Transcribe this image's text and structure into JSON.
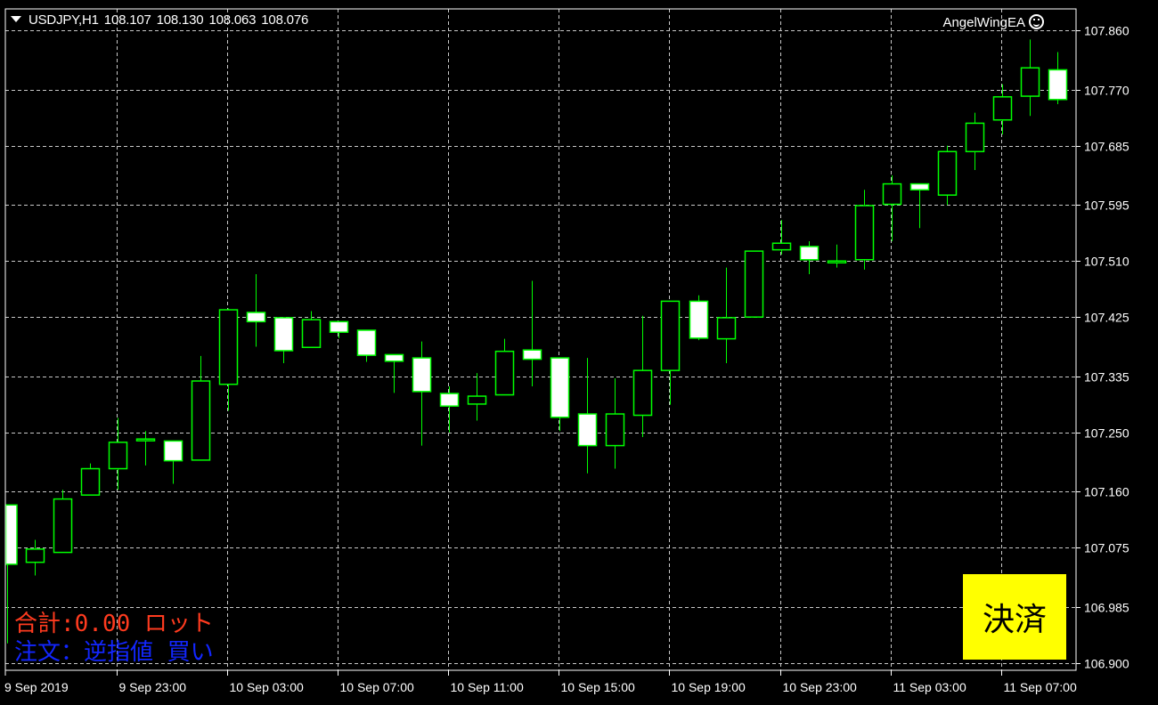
{
  "header": {
    "symbol": "USDJPY,H1",
    "open": "108.107",
    "high": "108.130",
    "low": "108.063",
    "close": "108.076"
  },
  "ea": {
    "name": "AngelWingEA"
  },
  "overlay": {
    "total_label": "合計:0.00 ロット",
    "order_label": "注文：逆指値 買い"
  },
  "close_button": {
    "label": "決済"
  },
  "colors": {
    "background": "#000000",
    "grid": "#c8c8c8",
    "bull_candle": "#00ff00",
    "bear_fill": "#ffffff",
    "button": "#ffff00"
  },
  "chart_data": {
    "type": "candlestick",
    "symbol": "USDJPY",
    "timeframe": "H1",
    "ylim": [
      106.9,
      107.86
    ],
    "y_ticks": [
      "107.860",
      "107.770",
      "107.685",
      "107.595",
      "107.510",
      "107.425",
      "107.335",
      "107.250",
      "107.160",
      "107.075",
      "106.985",
      "106.900"
    ],
    "x_ticks": [
      "9 Sep 2019",
      "9 Sep 23:00",
      "10 Sep 03:00",
      "10 Sep 07:00",
      "10 Sep 11:00",
      "10 Sep 15:00",
      "10 Sep 19:00",
      "10 Sep 23:00",
      "11 Sep 03:00",
      "11 Sep 07:00"
    ],
    "grid": true,
    "candles": [
      {
        "o": 107.14,
        "h": 107.14,
        "l": 106.93,
        "c": 107.05
      },
      {
        "o": 107.053,
        "h": 107.087,
        "l": 107.033,
        "c": 107.073
      },
      {
        "o": 107.068,
        "h": 107.163,
        "l": 107.068,
        "c": 107.149
      },
      {
        "o": 107.155,
        "h": 107.203,
        "l": 107.155,
        "c": 107.195
      },
      {
        "o": 107.195,
        "h": 107.272,
        "l": 107.163,
        "c": 107.235
      },
      {
        "o": 107.238,
        "h": 107.252,
        "l": 107.2,
        "c": 107.24
      },
      {
        "o": 107.237,
        "h": 107.237,
        "l": 107.172,
        "c": 107.207
      },
      {
        "o": 107.208,
        "h": 107.366,
        "l": 107.208,
        "c": 107.328
      },
      {
        "o": 107.323,
        "h": 107.438,
        "l": 107.283,
        "c": 107.436
      },
      {
        "o": 107.432,
        "h": 107.49,
        "l": 107.38,
        "c": 107.418
      },
      {
        "o": 107.424,
        "h": 107.424,
        "l": 107.355,
        "c": 107.374
      },
      {
        "o": 107.379,
        "h": 107.434,
        "l": 107.379,
        "c": 107.421
      },
      {
        "o": 107.418,
        "h": 107.418,
        "l": 107.393,
        "c": 107.402
      },
      {
        "o": 107.405,
        "h": 107.405,
        "l": 107.357,
        "c": 107.367
      },
      {
        "o": 107.368,
        "h": 107.368,
        "l": 107.31,
        "c": 107.358
      },
      {
        "o": 107.363,
        "h": 107.388,
        "l": 107.23,
        "c": 107.312
      },
      {
        "o": 107.309,
        "h": 107.32,
        "l": 107.25,
        "c": 107.29
      },
      {
        "o": 107.293,
        "h": 107.34,
        "l": 107.268,
        "c": 107.305
      },
      {
        "o": 107.307,
        "h": 107.392,
        "l": 107.307,
        "c": 107.373
      },
      {
        "o": 107.375,
        "h": 107.48,
        "l": 107.32,
        "c": 107.361
      },
      {
        "o": 107.363,
        "h": 107.363,
        "l": 107.252,
        "c": 107.273
      },
      {
        "o": 107.278,
        "h": 107.363,
        "l": 107.188,
        "c": 107.23
      },
      {
        "o": 107.23,
        "h": 107.332,
        "l": 107.195,
        "c": 107.278
      },
      {
        "o": 107.276,
        "h": 107.427,
        "l": 107.243,
        "c": 107.344
      },
      {
        "o": 107.344,
        "h": 107.448,
        "l": 107.292,
        "c": 107.449
      },
      {
        "o": 107.449,
        "h": 107.458,
        "l": 107.39,
        "c": 107.393
      },
      {
        "o": 107.392,
        "h": 107.5,
        "l": 107.355,
        "c": 107.424
      },
      {
        "o": 107.425,
        "h": 107.525,
        "l": 107.425,
        "c": 107.525
      },
      {
        "o": 107.527,
        "h": 107.572,
        "l": 107.52,
        "c": 107.537
      },
      {
        "o": 107.532,
        "h": 107.54,
        "l": 107.49,
        "c": 107.512
      },
      {
        "o": 107.508,
        "h": 107.535,
        "l": 107.5,
        "c": 107.51
      },
      {
        "o": 107.512,
        "h": 107.618,
        "l": 107.497,
        "c": 107.594
      },
      {
        "o": 107.596,
        "h": 107.64,
        "l": 107.54,
        "c": 107.627
      },
      {
        "o": 107.627,
        "h": 107.627,
        "l": 107.56,
        "c": 107.618
      },
      {
        "o": 107.61,
        "h": 107.685,
        "l": 107.595,
        "c": 107.676
      },
      {
        "o": 107.676,
        "h": 107.735,
        "l": 107.648,
        "c": 107.719
      },
      {
        "o": 107.724,
        "h": 107.778,
        "l": 107.702,
        "c": 107.759
      },
      {
        "o": 107.76,
        "h": 107.846,
        "l": 107.73,
        "c": 107.803
      },
      {
        "o": 107.8,
        "h": 107.827,
        "l": 107.748,
        "c": 107.755
      }
    ]
  }
}
